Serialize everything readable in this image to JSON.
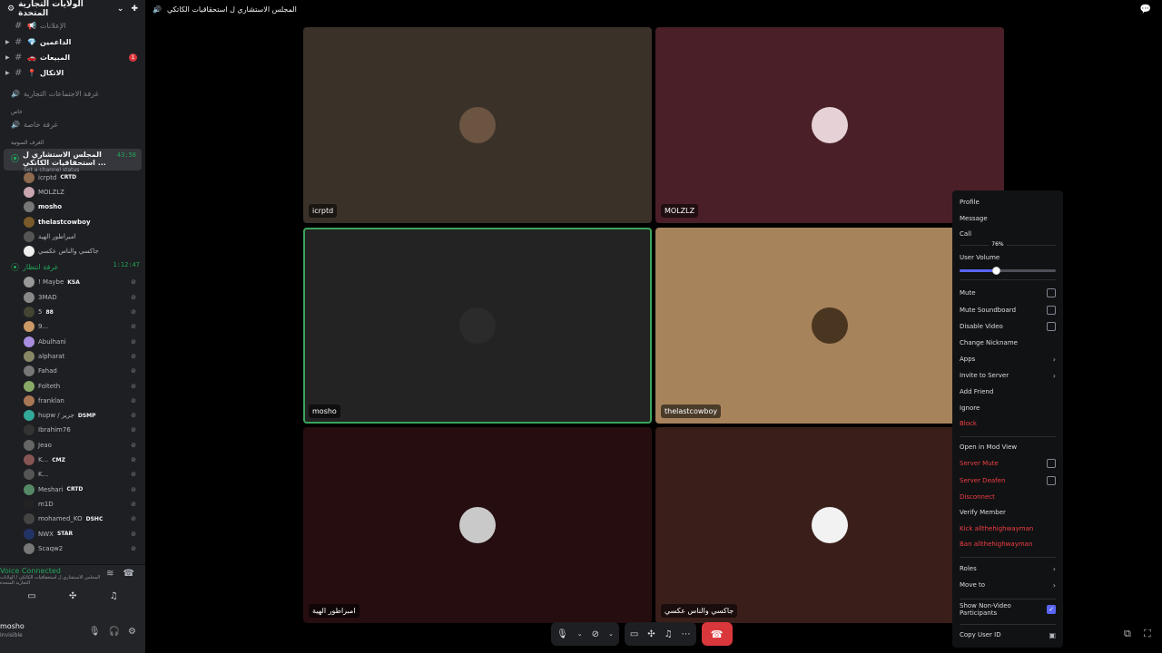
{
  "server": {
    "name": "الولايات التجارية المتحدة",
    "chevron": "⌄"
  },
  "channels": [
    {
      "name": "الإعلانات",
      "emoji": "📢",
      "expandable": false,
      "bold": false,
      "badge": ""
    },
    {
      "name": "الداعمين",
      "emoji": "💎",
      "expandable": true,
      "bold": true,
      "badge": ""
    },
    {
      "name": "المبيعات",
      "emoji": "🚗",
      "expandable": true,
      "bold": true,
      "badge": "1"
    },
    {
      "name": "الاتكال",
      "emoji": "📍",
      "expandable": true,
      "bold": true,
      "badge": ""
    }
  ],
  "voice_rooms": [
    {
      "name": "غرفة الاجتماعات التجارية"
    }
  ],
  "categories": {
    "private": "خاص",
    "room_private": "غرفة خاصة",
    "voice_category": "الغرف الصوتية"
  },
  "active_voice": {
    "name": "المجلس الاستشاري ل استحقاقيات الكاتكي ...",
    "status": "Set a channel status",
    "time": "43:58",
    "members": [
      {
        "name": "icrptd",
        "tag": "CRTD",
        "bold": false,
        "color": "#8e6a4f"
      },
      {
        "name": "MOLZLZ",
        "tag": "",
        "bold": false,
        "color": "#c9a6b0"
      },
      {
        "name": "mosho",
        "tag": "",
        "bold": true,
        "color": "#777"
      },
      {
        "name": "thelastcowboy",
        "tag": "",
        "bold": true,
        "color": "#7a5a2a"
      },
      {
        "name": "امبراطور الهية",
        "tag": "",
        "bold": false,
        "color": "#555"
      },
      {
        "name": "جاكسي والناس عكسي",
        "tag": "",
        "bold": false,
        "color": "#eee"
      }
    ]
  },
  "second_voice": {
    "name": "غرفة انتظار",
    "time": "1:12:47",
    "members": [
      {
        "name": "! Maybe",
        "tag": "KSA",
        "color": "#999"
      },
      {
        "name": "3MAD",
        "tag": "",
        "color": "#888"
      },
      {
        "name": "5",
        "tag": "88",
        "color": "#443"
      },
      {
        "name": "9...",
        "tag": "",
        "color": "#c96"
      },
      {
        "name": "Abulhani",
        "tag": "",
        "color": "#a98ee0"
      },
      {
        "name": "alpharat",
        "tag": "",
        "color": "#886"
      },
      {
        "name": "Fahad",
        "tag": "",
        "color": "#777"
      },
      {
        "name": "Folteth",
        "tag": "",
        "color": "#8a6"
      },
      {
        "name": "franklan",
        "tag": "",
        "color": "#a75"
      },
      {
        "name": "hupw / جرير",
        "tag": "DSMP",
        "color": "#3a9"
      },
      {
        "name": "Ibrahim76",
        "tag": "",
        "color": "#333"
      },
      {
        "name": "Jeao",
        "tag": "",
        "color": "#666"
      },
      {
        "name": "K...",
        "tag": "CMZ",
        "color": "#855"
      },
      {
        "name": "K...",
        "tag": "",
        "color": "#555"
      },
      {
        "name": "Meshari",
        "tag": "CRTD",
        "color": "#586"
      },
      {
        "name": "m1D",
        "tag": "",
        "color": "#222"
      },
      {
        "name": "mohamed_KO",
        "tag": "DSHC",
        "color": "#444"
      },
      {
        "name": "NWX",
        "tag": "STAR",
        "color": "#236"
      },
      {
        "name": "Scaqw2",
        "tag": "",
        "color": "#777"
      }
    ]
  },
  "voice_panel": {
    "title": "Voice Connected",
    "subtitle": "المجلس الاستشاري ل استحقاقيات الكاتكي / الولايات التجارية المتحدة"
  },
  "user": {
    "name": "mosho",
    "status": "Invisible"
  },
  "topbar": {
    "title": "المجلس الاستشاري ل استحقاقيات الكاتكي"
  },
  "tiles": [
    {
      "name": "icrptd",
      "bg": "#3a3128",
      "avatar": "#6b5442",
      "speaking": false
    },
    {
      "name": "MOLZLZ",
      "bg": "#4a1f27",
      "avatar": "#e6d2d6",
      "speaking": false
    },
    {
      "name": "mosho",
      "bg": "#232323",
      "avatar": "#2b2b2b",
      "speaking": true
    },
    {
      "name": "thelastcowboy",
      "bg": "#a7835c",
      "avatar": "#4a3520",
      "speaking": false
    },
    {
      "name": "امبراطور الهية",
      "bg": "#250d10",
      "avatar": "#c9c9c9",
      "speaking": false
    },
    {
      "name": "جاكسي والناس عكسي",
      "bg": "#3a1e1a",
      "avatar": "#f2f2f2",
      "speaking": false
    }
  ],
  "menu": {
    "items": [
      {
        "label": "Profile",
        "type": "item",
        "danger": false
      },
      {
        "label": "Message",
        "type": "item",
        "danger": false
      },
      {
        "label": "Call",
        "type": "item",
        "danger": false
      },
      {
        "label": "User Volume",
        "type": "slider",
        "danger": false
      },
      {
        "label": "Mute",
        "type": "check",
        "danger": false,
        "checked": false
      },
      {
        "label": "Mute Soundboard",
        "type": "check",
        "danger": false,
        "checked": false
      },
      {
        "label": "Disable Video",
        "type": "check",
        "danger": false,
        "checked": false
      },
      {
        "label": "Change Nickname",
        "type": "item",
        "danger": false
      },
      {
        "label": "Apps",
        "type": "sub",
        "danger": false
      },
      {
        "label": "Invite to Server",
        "type": "sub",
        "danger": false
      },
      {
        "label": "Add Friend",
        "type": "item",
        "danger": false
      },
      {
        "label": "Ignore",
        "type": "item",
        "danger": false
      },
      {
        "label": "Block",
        "type": "item",
        "danger": true
      },
      {
        "label": "Open in Mod View",
        "type": "item",
        "danger": false
      },
      {
        "label": "Server Mute",
        "type": "check",
        "danger": true,
        "checked": false
      },
      {
        "label": "Server Deafen",
        "type": "check",
        "danger": true,
        "checked": false
      },
      {
        "label": "Disconnect",
        "type": "item",
        "danger": true
      },
      {
        "label": "Verify Member",
        "type": "item",
        "danger": false
      },
      {
        "label": "Kick allthehighwayman",
        "type": "item",
        "danger": true
      },
      {
        "label": "Ban allthehighwayman",
        "type": "item",
        "danger": true
      },
      {
        "label": "Roles",
        "type": "sub",
        "danger": false
      },
      {
        "label": "Move to",
        "type": "sub",
        "danger": false
      },
      {
        "label": "Show Non-Video Participants",
        "type": "check",
        "danger": false,
        "checked": true
      },
      {
        "label": "Copy User ID",
        "type": "id",
        "danger": false
      }
    ],
    "volume_percent": 76,
    "volume_label": "76%"
  },
  "colors": {
    "accent": "#5865f2",
    "danger": "#f23f43",
    "green": "#23a55a"
  }
}
